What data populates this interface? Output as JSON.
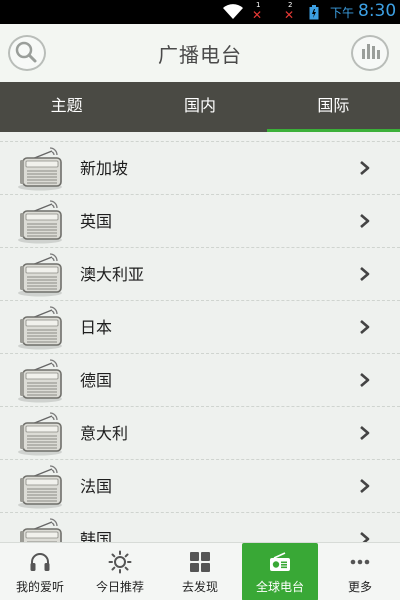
{
  "status_bar": {
    "sim1_label": "1",
    "sim2_label": "2",
    "ampm": "下午",
    "time": "8:30"
  },
  "header": {
    "title": "广播电台",
    "left_icon": "search-icon",
    "right_icon": "bar-chart-icon"
  },
  "tabs": [
    {
      "label": "主题",
      "active": false
    },
    {
      "label": "国内",
      "active": false
    },
    {
      "label": "国际",
      "active": true
    }
  ],
  "stations": [
    {
      "name": "新加坡"
    },
    {
      "name": "英国"
    },
    {
      "name": "澳大利亚"
    },
    {
      "name": "日本"
    },
    {
      "name": "德国"
    },
    {
      "name": "意大利"
    },
    {
      "name": "法国"
    },
    {
      "name": "韩国"
    }
  ],
  "bottom_nav": [
    {
      "label": "我的爱听",
      "icon": "headphones-icon",
      "active": false
    },
    {
      "label": "今日推荐",
      "icon": "sun-icon",
      "active": false
    },
    {
      "label": "去发现",
      "icon": "grid-icon",
      "active": false
    },
    {
      "label": "全球电台",
      "icon": "radio-icon",
      "active": true
    },
    {
      "label": "更多",
      "icon": "more-dots-icon",
      "active": false
    }
  ],
  "colors": {
    "accent": "#39a836",
    "tab_bar": "#4a4a44",
    "status_time": "#3da0e3"
  }
}
